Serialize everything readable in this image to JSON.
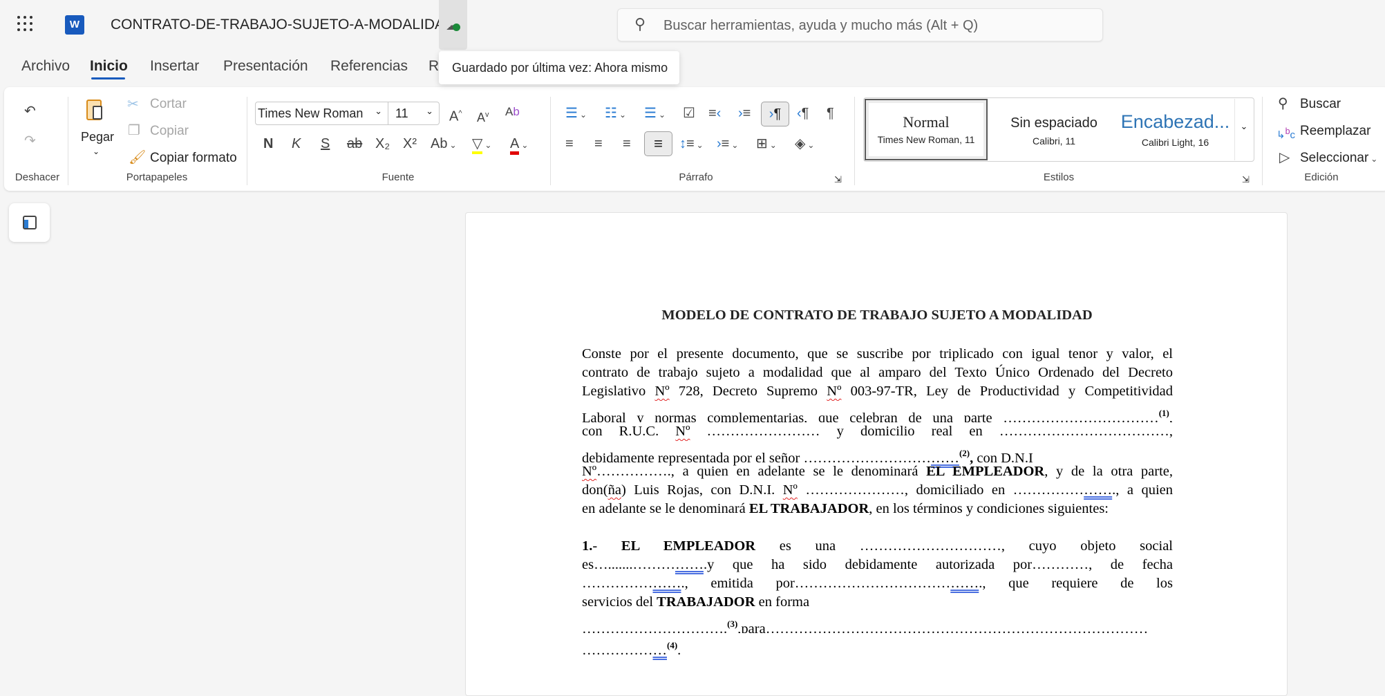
{
  "titlebar": {
    "app_icon": "word-icon",
    "doc_title": "CONTRATO-DE-TRABAJO-SUJETO-A-MODALIDAD",
    "search_placeholder": "Buscar herramientas, ayuda y mucho más (Alt + Q)",
    "tooltip": "Guardado por última vez: Ahora mismo"
  },
  "tabs": [
    "Archivo",
    "Inicio",
    "Insertar",
    "Presentación",
    "Referencias",
    "R"
  ],
  "active_tab": "Inicio",
  "ribbon": {
    "deshacer": {
      "label": "Deshacer"
    },
    "portapapeles": {
      "label": "Portapapeles",
      "paste": "Pegar",
      "cut": "Cortar",
      "copy": "Copiar",
      "format_painter": "Copiar formato"
    },
    "fuente": {
      "label": "Fuente",
      "font": "Times New Roman",
      "size": "11",
      "bold": "N",
      "italic": "K",
      "underline": "S",
      "strike": "ab",
      "sub": "X₂",
      "sup": "X²",
      "case": "Ab"
    },
    "parrafo": {
      "label": "Párrafo"
    },
    "estilos": {
      "label": "Estilos",
      "items": [
        {
          "name": "Normal",
          "desc": "Times New Roman, 11"
        },
        {
          "name": "Sin espaciado",
          "desc": "Calibri, 11"
        },
        {
          "name": "Encabezad...",
          "desc": "Calibri Light, 16"
        }
      ]
    },
    "edicion": {
      "label": "Edición",
      "find": "Buscar",
      "replace": "Reemplazar",
      "select": "Seleccionar"
    }
  },
  "colors": {
    "accent": "#185abd",
    "heading_blue": "#2e74b5",
    "font_color": "#e00000",
    "highlight": "#ffff00"
  },
  "document": {
    "title": "MODELO DE CONTRATO DE TRABAJO SUJETO A MODALIDAD",
    "lines": [
      {
        "j": true,
        "s": [
          {
            "t": "Conste por el presente documento, que se suscribe por triplicado con igual tenor y valor, el"
          }
        ]
      },
      {
        "j": true,
        "s": [
          {
            "t": "contrato de trabajo sujeto a modalidad que al amparo del Texto Único Ordenado del Decreto"
          }
        ]
      },
      {
        "j": true,
        "s": [
          {
            "t": "Legislativo "
          },
          {
            "t": "Nº",
            "q": 1
          },
          {
            "t": " 728, Decreto Supremo "
          },
          {
            "t": "Nº",
            "q": 1
          },
          {
            "t": " 003-97-TR, Ley de Productividad y Competitividad"
          }
        ]
      },
      {
        "j": true,
        "s": [
          {
            "t": "Laboral y normas complementarias, que celebran de una parte …………………………"
          },
          {
            "t": "…",
            "u": 1
          },
          {
            "t": "(1)",
            "sup": 1
          },
          {
            "t": ","
          }
        ]
      },
      {
        "j": true,
        "s": [
          {
            "t": "con R.U.C. "
          },
          {
            "t": "Nº",
            "q": 1
          },
          {
            "t": " …………………… y domicilio real en ………………………………,"
          }
        ]
      },
      {
        "j": false,
        "s": [
          {
            "t": "debidamente representada por el señor ………………………"
          },
          {
            "t": "……",
            "u": 1
          },
          {
            "t": "(2)",
            "sup": 1
          },
          {
            "t": ",",
            "b": 1
          },
          {
            "t": " con D.N.I"
          }
        ]
      },
      {
        "j": true,
        "s": [
          {
            "t": "Nº",
            "q": 1
          },
          {
            "t": "……………., a quien en adelante se le denominará "
          },
          {
            "t": "EL EMPLEADOR",
            "b": 1
          },
          {
            "t": ", y de la otra parte,"
          }
        ]
      },
      {
        "j": true,
        "s": [
          {
            "t": "don("
          },
          {
            "t": "ña",
            "q": 1
          },
          {
            "t": ") Luis Rojas, con D.N.I. "
          },
          {
            "t": "Nº",
            "q": 1
          },
          {
            "t": " …………………, domiciliado en ……………"
          },
          {
            "t": "……",
            "u": 1
          },
          {
            "t": "., a quien"
          }
        ]
      },
      {
        "j": false,
        "s": [
          {
            "t": "en adelante se le denominará "
          },
          {
            "t": "EL TRABAJADOR",
            "b": 1
          },
          {
            "t": ", en los términos y condiciones siguientes:"
          }
        ]
      },
      {
        "gap": true,
        "s": []
      },
      {
        "j": true,
        "s": [
          {
            "t": "1.",
            "b": 1
          },
          {
            "t": "- "
          },
          {
            "t": "EL EMPLEADOR",
            "b": 1
          },
          {
            "t": " es una …………………………, cuyo objeto social"
          }
        ]
      },
      {
        "j": true,
        "s": [
          {
            "t": "es….......………"
          },
          {
            "t": "……",
            "u": 1
          },
          {
            "t": ".y que ha sido debidamente autorizada por…………, de fecha"
          }
        ]
      },
      {
        "j": true,
        "s": [
          {
            "t": "……………"
          },
          {
            "t": "……",
            "u": 1
          },
          {
            "t": "., emitida por……………………………"
          },
          {
            "t": "……",
            "u": 1
          },
          {
            "t": "., que requiere de los"
          }
        ]
      },
      {
        "j": false,
        "s": [
          {
            "t": "servicios del "
          },
          {
            "t": "TRABAJADOR",
            "b": 1
          },
          {
            "t": " en forma"
          }
        ]
      },
      {
        "j": true,
        "s": [
          {
            "t": "……………………"
          },
          {
            "t": "……",
            "u": 1
          },
          {
            "t": "."
          },
          {
            "t": "(3)",
            "sup": 1
          },
          {
            "t": ",para",
            "u": 1
          },
          {
            "t": "………………………………………………………………………"
          }
        ]
      },
      {
        "j": false,
        "s": [
          {
            "t": "……………"
          },
          {
            "t": "…",
            "u": 1
          },
          {
            "t": "(4)",
            "sup": 1
          },
          {
            "t": "."
          }
        ]
      }
    ]
  }
}
